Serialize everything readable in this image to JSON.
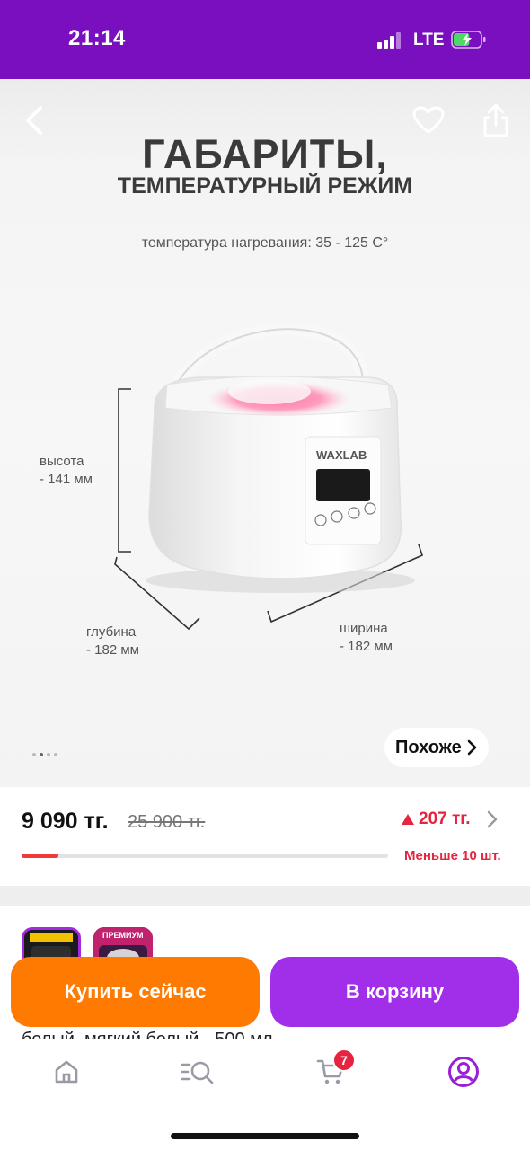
{
  "status_bar": {
    "time": "21:14",
    "network": "LTE",
    "battery_level_percent": 60
  },
  "gallery": {
    "title": "ГАБАРИТЫ,",
    "subtitle": "ТЕМПЕРАТУРНЫЙ РЕЖИМ",
    "temperature": "температура нагревания: 35 - 125 С°",
    "height_label": "высота",
    "height_value": "- 141 мм",
    "depth_label": "глубина",
    "depth_value": "- 182 мм",
    "width_label": "ширина",
    "width_value": "- 182 мм",
    "brand_logo": "WAXLAB",
    "dots": {
      "count": 4,
      "active": 1
    },
    "similar_label": "Похоже"
  },
  "price": {
    "current": "9 090 тг.",
    "old": "25 900 тг.",
    "diff": "207 тг.",
    "stock_text": "Меньше 10 шт.",
    "stock_fraction": 0.1
  },
  "variants": {
    "thumb_badge": "ПРЕМИУМ",
    "description": "белый, мягкий белый - 500 мл"
  },
  "actions": {
    "buy_now": "Купить сейчас",
    "add_to_cart": "В корзину"
  },
  "tab_bar": {
    "cart_count": "7",
    "icons": [
      "home-icon",
      "catalog-search-icon",
      "cart-icon",
      "profile-icon"
    ]
  },
  "colors": {
    "brand_purple": "#7a0fbf",
    "accent_orange": "#ff7a00",
    "accent_violet": "#a12ee8",
    "alert_red": "#e5243f"
  }
}
